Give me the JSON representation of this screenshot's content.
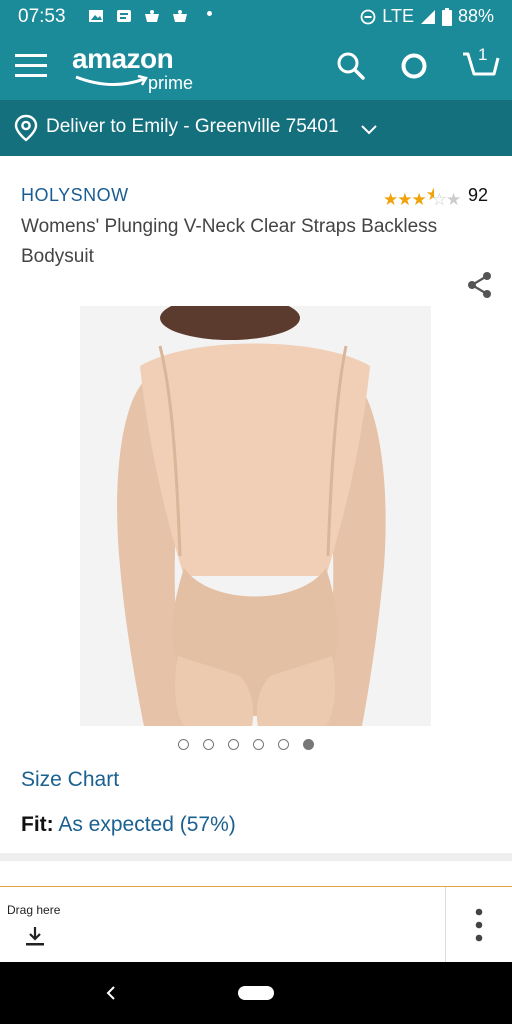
{
  "status_bar": {
    "time": "07:53",
    "network": "LTE",
    "battery": "88%"
  },
  "header": {
    "logo_main": "amazon",
    "logo_sub": "prime",
    "cart_count": "1",
    "icons": [
      "menu-icon",
      "search-icon",
      "alexa-icon",
      "cart-icon"
    ]
  },
  "deliver": {
    "text": "Deliver to Emily - Greenville 75401"
  },
  "product": {
    "brand": "HOLYSNOW",
    "rating_count": "92",
    "rating_stars": 3.5,
    "title": "Womens' Plunging V-Neck Clear Straps Backless Bodysuit",
    "image_count": 6,
    "active_image_index": 5,
    "size_chart_label": "Size Chart",
    "fit_label": "Fit:",
    "fit_value": "As expected (57%)"
  },
  "drag_panel": {
    "label": "Drag here"
  },
  "colors": {
    "header": "#1b8a99",
    "deliver_bar": "#15707d",
    "link": "#1a6090",
    "star": "#f0a30a"
  }
}
